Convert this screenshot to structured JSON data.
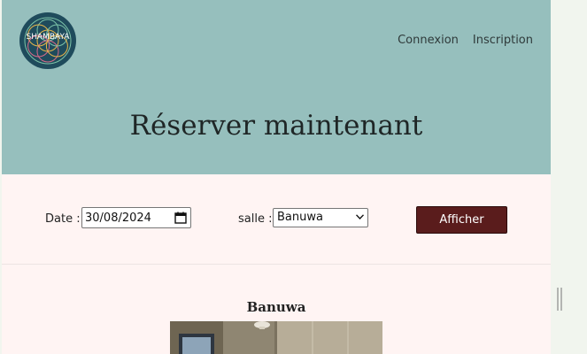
{
  "header": {
    "logo_text": "SHAMBAYA",
    "nav": [
      "Connexion",
      "Inscription"
    ],
    "title": "Réserver maintenant"
  },
  "filters": {
    "date_label": "Date :",
    "date_value": "30/08/2024",
    "salle_label": "salle :",
    "salle_value": "Banuwa",
    "submit_label": "Afficher"
  },
  "room": {
    "name": "Banuwa"
  },
  "colors": {
    "header_bg": "#96bfbd",
    "content_bg": "#fff4f3",
    "button_bg": "#5a1c1c",
    "logo_bg": "#1f4b5c"
  }
}
